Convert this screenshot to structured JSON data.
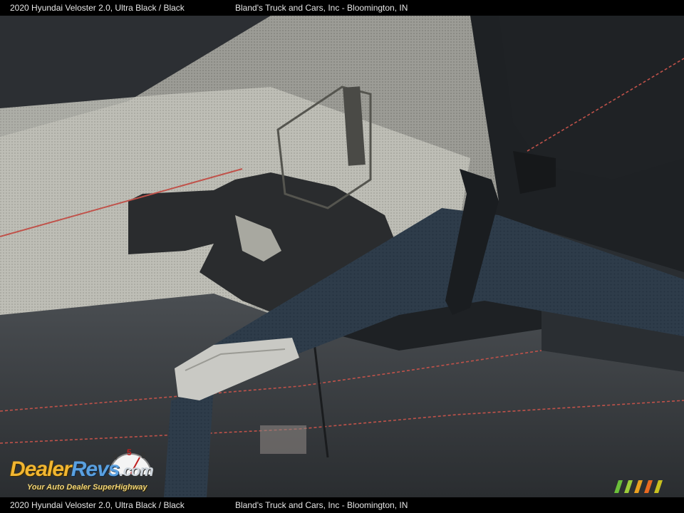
{
  "caption": {
    "vehicle": "2020 Hyundai Veloster 2.0,  Ultra Black / Black",
    "dealer": "Bland's Truck and Cars, Inc - Bloomington, IN"
  },
  "watermark": {
    "part1": "Dealer",
    "part2": "Revs",
    "part3": ".com",
    "tagline": "Your Auto Dealer SuperHighway",
    "gauge_numbers": [
      "4",
      "5",
      "6"
    ]
  },
  "photo": {
    "subject": "seatbelt-across-seat",
    "colors": {
      "seat_fabric": "#6e6e6a",
      "sunlit_fabric": "#b8b8b0",
      "leather": "#3a3d40",
      "belt": "#2c3a48",
      "stitching": "#c0524a"
    }
  },
  "stripe_colors": [
    "#6bbf3a",
    "#9ccc3a",
    "#e8a020",
    "#e86a20",
    "#c8c020"
  ]
}
